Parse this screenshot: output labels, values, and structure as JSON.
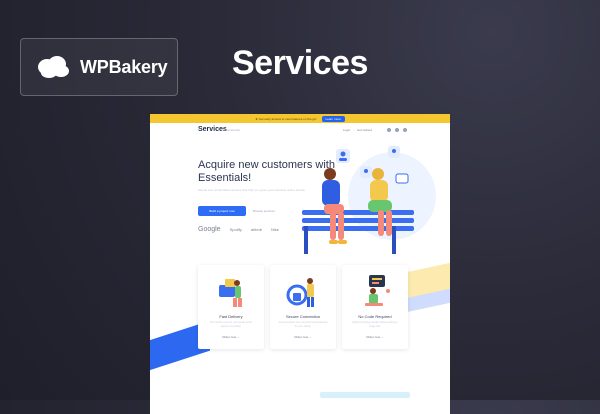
{
  "brand": {
    "name": "WPBakery"
  },
  "headline": "Services",
  "site": {
    "topbar": {
      "text": "★ Get early access to new features on the go!",
      "button": "Learn more"
    },
    "nav": {
      "logo": "Services",
      "logo_sub": "Ecommerce",
      "links": [
        "Login",
        "Get started"
      ]
    },
    "hero": {
      "title": "Acquire new customers with Essentials!",
      "description": "Simple and comfortable services that help you grow your business online quickly.",
      "cta": "Build a project now",
      "secondary_link": "Browse services"
    },
    "logos": [
      "Google",
      "Spotify",
      "airbnb",
      "Nike"
    ],
    "cards": [
      {
        "title": "Fast Delivery",
        "description": "Our service ensures your goods arrive quickly and safely.",
        "link": "Order now →"
      },
      {
        "title": "Secure Connection",
        "description": "All connections are encrypted and protected for your safety.",
        "link": "Order now →"
      },
      {
        "title": "No Code Required",
        "description": "Build everything visually without writing a single line.",
        "link": "Order now →"
      }
    ]
  },
  "colors": {
    "accent_blue": "#2f6cf6",
    "accent_yellow": "#f4c62f",
    "background_dark": "#2a2a38"
  }
}
